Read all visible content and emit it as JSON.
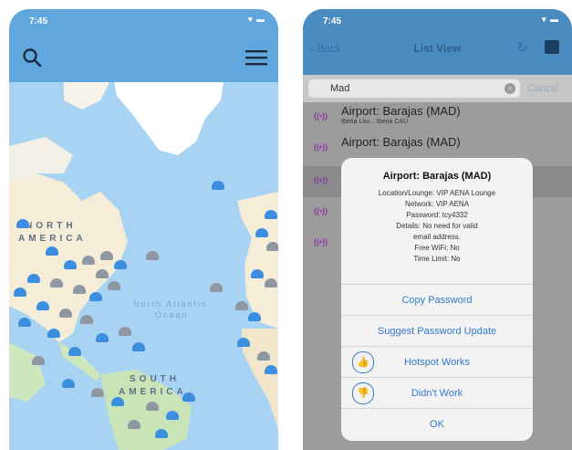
{
  "left_phone": {
    "status_time": "7:45",
    "status_icons": "▾ ▬",
    "search_icon": "search-icon",
    "menu_icon": "hamburger-menu-icon",
    "map": {
      "labels": {
        "north": "NORTH",
        "america": "AMERICA",
        "ocean_1": "North Atlantic",
        "ocean_2": "Ocean",
        "south": "SOUTH",
        "south_america": "AMERICA"
      }
    }
  },
  "right_phone": {
    "status_time": "7:45",
    "status_icons": "▾ ▬",
    "nav": {
      "back": "Back",
      "title": "List View"
    },
    "search": {
      "value": "Mad",
      "cancel": "Cancel"
    },
    "rows": [
      {
        "title": "Airport: Barajas (MAD)",
        "sub": "Iberia Lou...    Iberia        CAU"
      },
      {
        "title": "Airport: Barajas (MAD)",
        "sub": ""
      }
    ],
    "alert": {
      "title": "Airport: Barajas (MAD)",
      "lines": [
        "Location/Lounge: VIP AENA Lounge",
        "Network: VIP AENA",
        "Password: tcy4332",
        "Details: No need for valid",
        "email address.",
        "Free WiFi: No",
        "Time Limit: No"
      ],
      "buttons": {
        "copy": "Copy Password",
        "suggest": "Suggest Password Update",
        "works": "Hotspot Works",
        "didnt": "Didn't Work",
        "ok": "OK"
      }
    }
  },
  "colors": {
    "map_ocean": "#a8d3f2",
    "pin_blue": "#3c8ee0",
    "pin_gray": "#8f98a2",
    "nav_blue": "#5fa7dd"
  }
}
